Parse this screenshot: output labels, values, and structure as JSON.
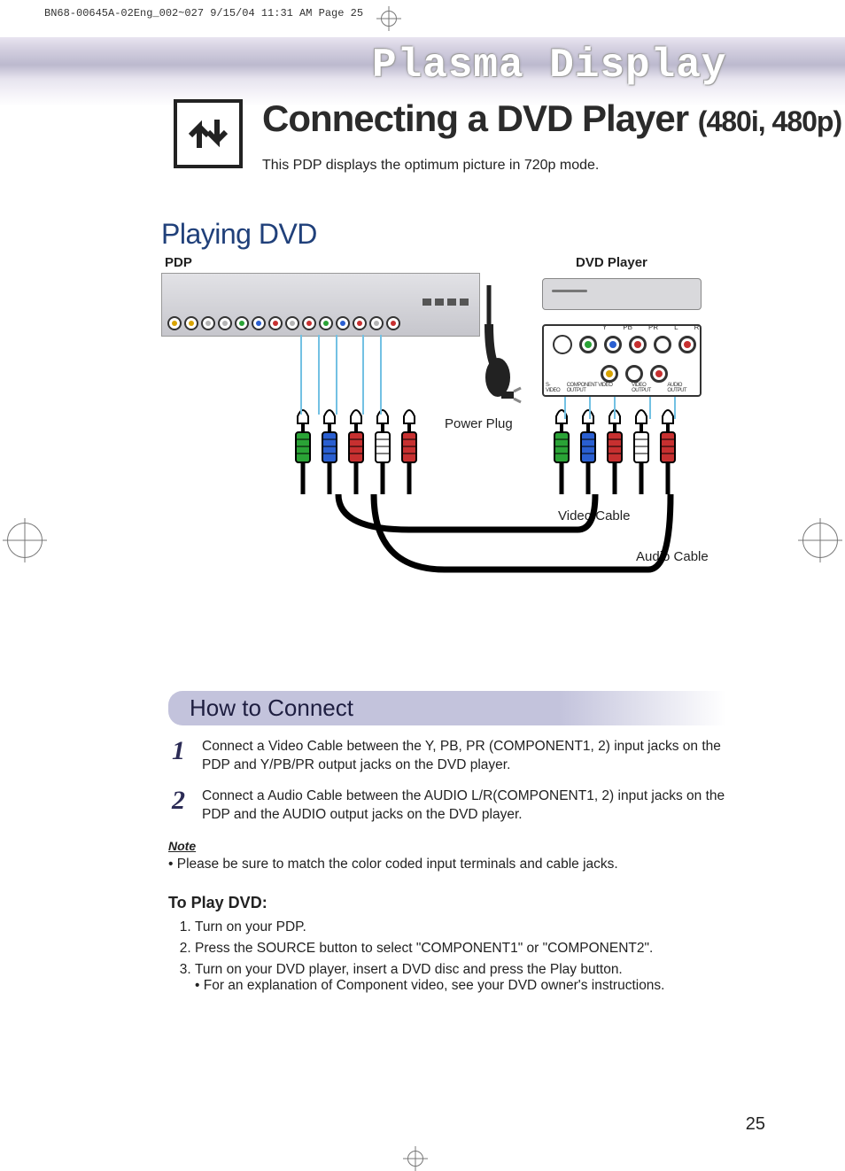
{
  "print_marks": {
    "header": "BN68-00645A-02Eng_002~027  9/15/04  11:31 AM  Page 25"
  },
  "banner": {
    "title": "Plasma Display"
  },
  "page": {
    "title_main": "Connecting a DVD Player",
    "title_sub": "(480i, 480p)",
    "subtitle": "This PDP displays the optimum picture in 720p mode."
  },
  "section_playing": "Playing DVD",
  "diagram": {
    "label_pdp": "PDP",
    "label_dvd": "DVD Player",
    "power_plug": "Power Plug",
    "video_cable": "Video Cable",
    "audio_cable": "Audio Cable",
    "dvd_jack_top_labels": [
      "Y",
      "PB",
      "PR",
      "L",
      "R"
    ],
    "dvd_panel_bottom_labels": [
      "S-VIDEO",
      "COMPONENT VIDEO OUTPUT",
      "VIDEO OUTPUT",
      "AUDIO OUTPUT"
    ],
    "pdp_port_colors": [
      "#d9a400",
      "#d9a400",
      "#b5b5b5",
      "#b5b5b5",
      "#2aa336",
      "#2a5fd1",
      "#c73030",
      "#b5b5b5",
      "#c73030",
      "#2aa336",
      "#2a5fd1",
      "#c73030",
      "#b5b5b5",
      "#c73030"
    ],
    "dvd_top_jack_colors": [
      "#2aa336",
      "#2a5fd1",
      "#c73030",
      "#ffffff",
      "#c73030"
    ],
    "dvd_bot_jack_colors": [
      "#d9a400",
      "#ffffff",
      "#c73030"
    ],
    "pdp_plug_colors": [
      "#2aa336",
      "#2a5fd1",
      "#c73030",
      "#ffffff",
      "#c73030"
    ],
    "dvd_plug_colors": [
      "#2aa336",
      "#2a5fd1",
      "#c73030",
      "#ffffff",
      "#c73030"
    ]
  },
  "howto": {
    "heading": "How to Connect",
    "steps": [
      "Connect a Video Cable between the Y, PB, PR (COMPONENT1, 2) input jacks on the PDP and Y/PB/PR output jacks on the DVD player.",
      "Connect a Audio Cable between the AUDIO L/R(COMPONENT1, 2) input jacks on the PDP and the AUDIO output jacks on the DVD player."
    ],
    "note_label": "Note",
    "note_bullet": "•  Please be sure to match the color coded input terminals and cable jacks.",
    "toplay_title": "To Play DVD:",
    "toplay_steps": [
      {
        "text": "Turn on your PDP."
      },
      {
        "text": "Press the SOURCE button to select \"COMPONENT1\" or \"COMPONENT2\"."
      },
      {
        "text": "Turn on your DVD player, insert a DVD disc and press the Play button.",
        "sub": "• For an explanation of Component video, see your DVD owner's instructions."
      }
    ]
  },
  "page_number": "25"
}
